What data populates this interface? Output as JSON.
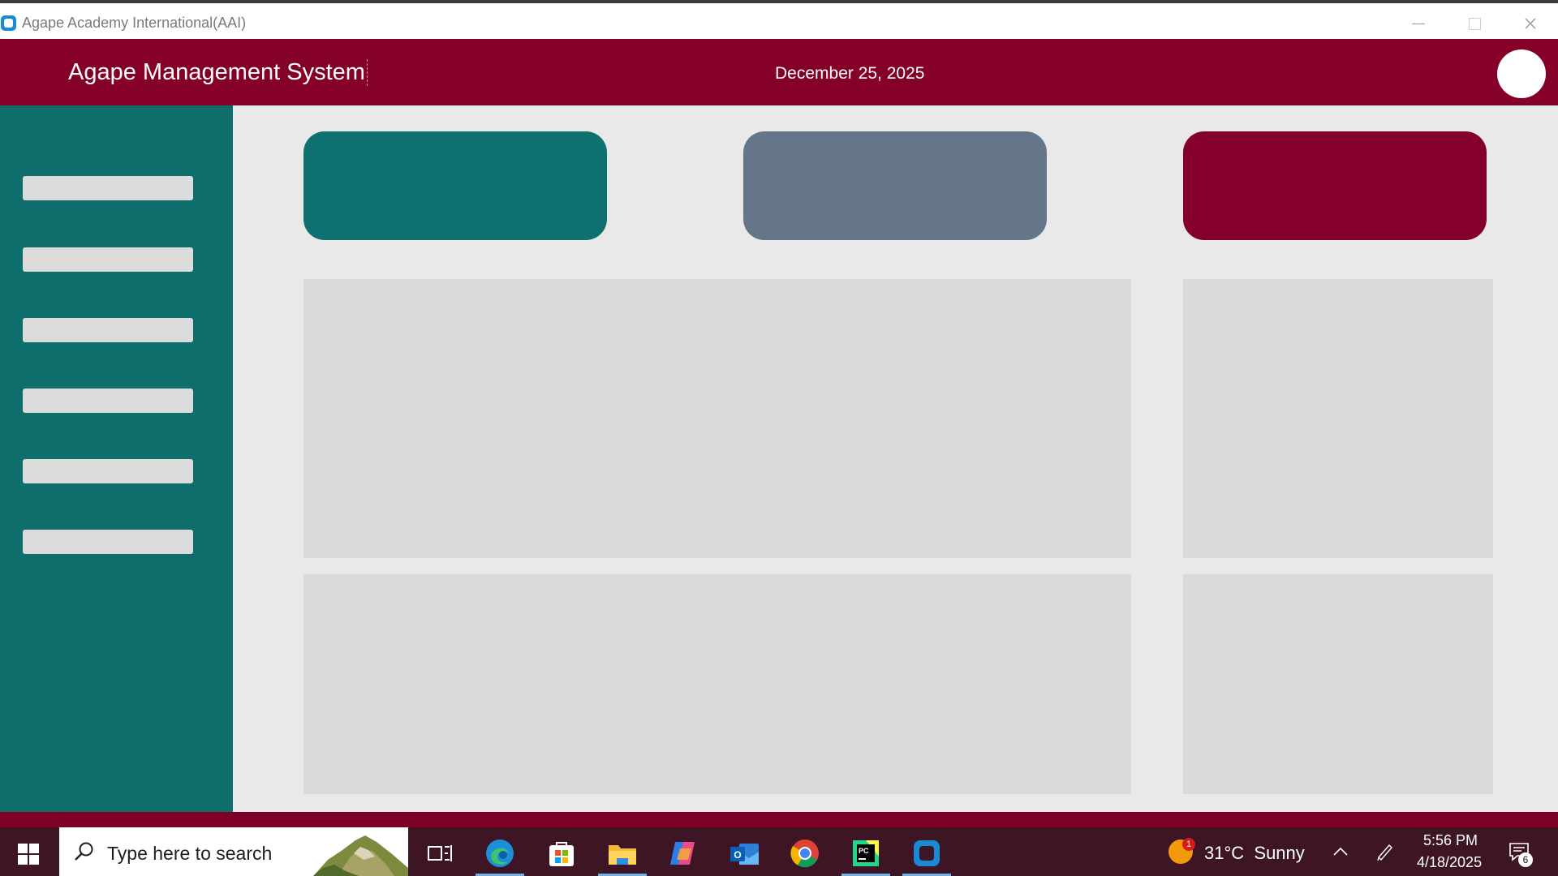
{
  "window": {
    "title": "Agape Academy International(AAI)"
  },
  "header": {
    "title": "Agape Management System",
    "date": "December 25, 2025"
  },
  "sidebar": {
    "items": [
      "",
      "",
      "",
      "",
      "",
      ""
    ]
  },
  "colors": {
    "header": "#840028",
    "sidebar": "#0e6e6c",
    "card_teal": "#0f716f",
    "card_slate": "#66768a",
    "card_maroon": "#84002a",
    "panel": "#dadada",
    "main_bg": "#e9e9e9"
  },
  "taskbar": {
    "search_placeholder": "Type here to search",
    "apps": [
      "task-view-icon",
      "edge-icon",
      "store-icon",
      "file-explorer-icon",
      "copilot-icon",
      "outlook-icon",
      "chrome-icon",
      "pycharm-icon",
      "app-window-icon"
    ],
    "weather": {
      "temperature": "31°C",
      "condition": "Sunny",
      "badge": "1"
    },
    "clock": {
      "time": "5:56 PM",
      "date": "4/18/2025"
    },
    "notification_count": "6"
  }
}
